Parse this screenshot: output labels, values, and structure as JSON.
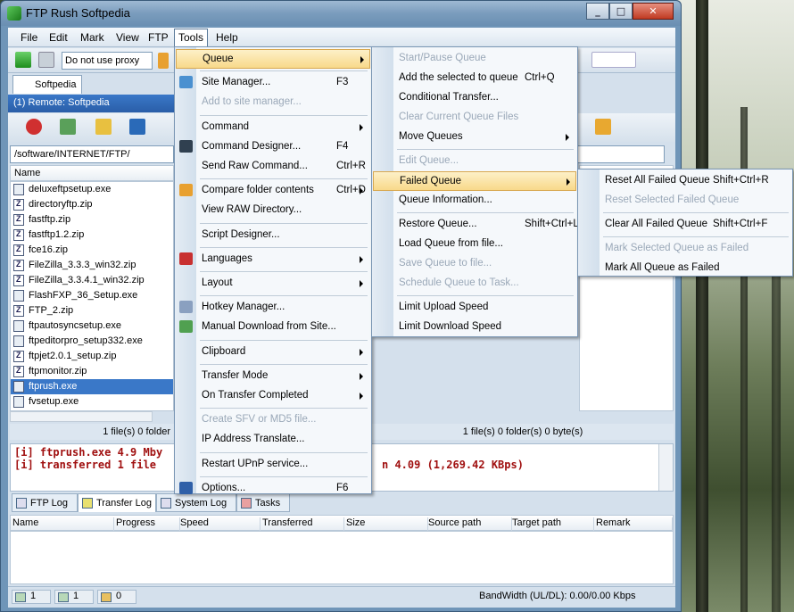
{
  "window": {
    "title": "FTP Rush   Softpedia",
    "min": "_",
    "max": "□",
    "close": "✕"
  },
  "menubar": [
    "File",
    "Edit",
    "Mark",
    "View",
    "FTP",
    "Tools",
    "Help"
  ],
  "toolbar": {
    "proxy": "Do not use proxy"
  },
  "tab": {
    "label": "Softpedia"
  },
  "remote": {
    "label": "(1) Remote:  Softpedia"
  },
  "path": "/software/INTERNET/FTP/",
  "list": {
    "header": "Name",
    "files": [
      {
        "name": "deluxeftpsetup.exe",
        "type": "exe"
      },
      {
        "name": "directoryftp.zip",
        "type": "zip"
      },
      {
        "name": "fastftp.zip",
        "type": "zip"
      },
      {
        "name": "fastftp1.2.zip",
        "type": "zip"
      },
      {
        "name": "fce16.zip",
        "type": "zip"
      },
      {
        "name": "FileZilla_3.3.3_win32.zip",
        "type": "zip"
      },
      {
        "name": "FileZilla_3.3.4.1_win32.zip",
        "type": "zip"
      },
      {
        "name": "FlashFXP_36_Setup.exe",
        "type": "exe"
      },
      {
        "name": "FTP_2.zip",
        "type": "zip"
      },
      {
        "name": "ftpautosyncsetup.exe",
        "type": "exe"
      },
      {
        "name": "ftpeditorpro_setup332.exe",
        "type": "exe"
      },
      {
        "name": "ftpjet2.0.1_setup.zip",
        "type": "zip"
      },
      {
        "name": "ftpmonitor.zip",
        "type": "zip"
      },
      {
        "name": "ftprush.exe",
        "type": "exe",
        "selected": true
      },
      {
        "name": "fvsetup.exe",
        "type": "exe"
      }
    ]
  },
  "status": {
    "left": "1 file(s) 0 folder",
    "right": "1 file(s) 0 folder(s) 0 byte(s)"
  },
  "log": {
    "line1": "[i] ftprush.exe 4.9 Mby",
    "line2": "[i] transferred 1 file",
    "line2_end": "n 4.09 (1,269.42 KBps)"
  },
  "logtabs": [
    "FTP Log",
    "Transfer Log",
    "System Log",
    "Tasks"
  ],
  "queue_headers": [
    "Name",
    "Progress",
    "Speed",
    "Transferred",
    "Size",
    "Source path",
    "Target path",
    "Remark"
  ],
  "bottom": {
    "a": "1",
    "b": "1",
    "c": "0",
    "bandwidth": "BandWidth (UL/DL): 0.00/0.00 Kbps"
  },
  "tools_menu": [
    {
      "label": "Queue",
      "arrow": true,
      "hl": true
    },
    {
      "sep": true
    },
    {
      "label": "Site Manager...",
      "sc": "F3"
    },
    {
      "label": "Add to site manager...",
      "dis": true
    },
    {
      "sep": true
    },
    {
      "label": "Command",
      "arrow": true
    },
    {
      "label": "Command Designer...",
      "sc": "F4"
    },
    {
      "label": "Send Raw Command...",
      "sc": "Ctrl+R"
    },
    {
      "sep": true
    },
    {
      "label": "Compare folder contents",
      "sc": "Ctrl+D",
      "arrow": true
    },
    {
      "label": "View RAW Directory..."
    },
    {
      "sep": true
    },
    {
      "label": "Script Designer..."
    },
    {
      "sep": true
    },
    {
      "label": "Languages",
      "arrow": true
    },
    {
      "sep": true
    },
    {
      "label": "Layout",
      "arrow": true
    },
    {
      "sep": true
    },
    {
      "label": "Hotkey Manager..."
    },
    {
      "label": "Manual Download from Site..."
    },
    {
      "sep": true
    },
    {
      "label": "Clipboard",
      "arrow": true
    },
    {
      "sep": true
    },
    {
      "label": "Transfer Mode",
      "arrow": true
    },
    {
      "label": "On Transfer Completed",
      "arrow": true
    },
    {
      "sep": true
    },
    {
      "label": "Create SFV or MD5 file...",
      "dis": true
    },
    {
      "label": "IP Address Translate..."
    },
    {
      "sep": true
    },
    {
      "label": "Restart UPnP service..."
    },
    {
      "sep": true
    },
    {
      "label": "Options...",
      "sc": "F6"
    }
  ],
  "queue_menu": [
    {
      "label": "Start/Pause Queue",
      "dis": true
    },
    {
      "label": "Add the selected to queue",
      "sc": "Ctrl+Q"
    },
    {
      "label": "Conditional Transfer..."
    },
    {
      "label": "Clear Current Queue Files",
      "dis": true
    },
    {
      "label": "Move Queues",
      "arrow": true
    },
    {
      "sep": true
    },
    {
      "label": "Edit Queue...",
      "dis": true
    },
    {
      "label": "Failed Queue",
      "arrow": true,
      "hl": true
    },
    {
      "label": "Queue Information..."
    },
    {
      "sep": true
    },
    {
      "label": "Restore Queue...",
      "sc": "Shift+Ctrl+L"
    },
    {
      "label": "Load Queue from file..."
    },
    {
      "label": "Save Queue to file...",
      "dis": true
    },
    {
      "label": "Schedule Queue to Task...",
      "dis": true
    },
    {
      "sep": true
    },
    {
      "label": "Limit Upload Speed"
    },
    {
      "label": "Limit Download Speed"
    }
  ],
  "failed_menu": [
    {
      "label": "Reset All Failed Queue",
      "sc": "Shift+Ctrl+R"
    },
    {
      "label": "Reset Selected Failed Queue",
      "dis": true
    },
    {
      "sep": true
    },
    {
      "label": "Clear All Failed Queue",
      "sc": "Shift+Ctrl+F"
    },
    {
      "sep": true
    },
    {
      "label": "Mark Selected Queue as Failed",
      "dis": true
    },
    {
      "label": "Mark All Queue as Failed"
    }
  ],
  "colors": {
    "accent": "#3a78c8",
    "highlight": "#f8d98a",
    "log_text": "#a01010"
  }
}
